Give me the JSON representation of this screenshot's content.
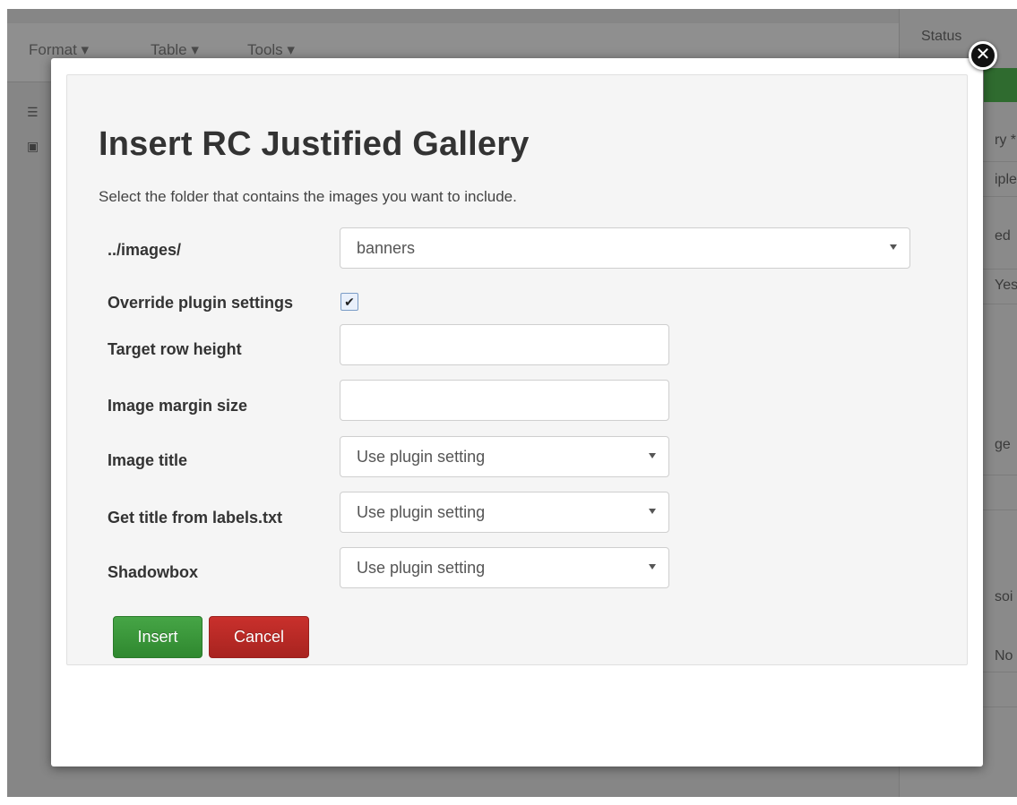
{
  "background": {
    "menus": [
      "Format ▾",
      "Table ▾",
      "Tools ▾"
    ],
    "sidebar_title": "Status",
    "sidebar_fragments": [
      "ry *",
      "iple",
      "ed",
      "Yes",
      "ge",
      "soi",
      "No"
    ]
  },
  "modal": {
    "title": "Insert RC Justified Gallery",
    "subtitle": "Select the folder that contains the images you want to include.",
    "folder": {
      "label": "../images/",
      "value": "banners"
    },
    "override": {
      "label": "Override plugin settings",
      "checked": true,
      "check_glyph": "✔"
    },
    "target_row_height": {
      "label": "Target row height",
      "value": ""
    },
    "image_margin_size": {
      "label": "Image margin size",
      "value": ""
    },
    "image_title": {
      "label": "Image title",
      "value": "Use plugin setting"
    },
    "title_from_labels": {
      "label": "Get title from labels.txt",
      "value": "Use plugin setting"
    },
    "shadowbox": {
      "label": "Shadowbox",
      "value": "Use plugin setting"
    },
    "insert_label": "Insert",
    "cancel_label": "Cancel",
    "close_glyph": "✕"
  },
  "colors": {
    "insert": "#3a9a3a",
    "cancel": "#b72a26",
    "overlay": "#868686"
  }
}
